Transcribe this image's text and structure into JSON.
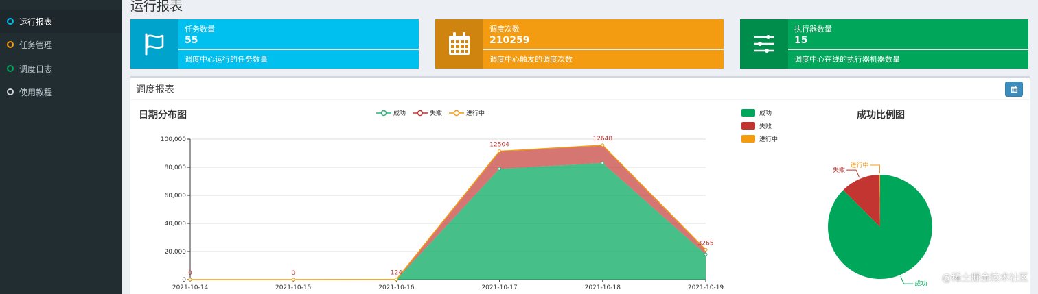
{
  "sidebar": {
    "items": [
      {
        "label": "运行报表",
        "ring": "#00c0ef",
        "active": true
      },
      {
        "label": "任务管理",
        "ring": "#f39c12",
        "active": false
      },
      {
        "label": "调度日志",
        "ring": "#00a65a",
        "active": false
      },
      {
        "label": "使用教程",
        "ring": "#d2d6de",
        "active": false
      }
    ]
  },
  "page": {
    "title": "运行报表"
  },
  "info_boxes": [
    {
      "label": "任务数量",
      "number": "55",
      "desc": "调度中心运行的任务数量",
      "color": "#00c0ef",
      "icon": "flag-icon"
    },
    {
      "label": "调度次数",
      "number": "210259",
      "desc": "调度中心触发的调度次数",
      "color": "#f39c12",
      "icon": "calendar-icon"
    },
    {
      "label": "执行器数量",
      "number": "15",
      "desc": "调度中心在线的执行器机器数量",
      "color": "#00a65a",
      "icon": "sliders-icon"
    }
  ],
  "report": {
    "title": "调度报表"
  },
  "line_chart_title": "日期分布图",
  "pie_chart_title": "成功比例图",
  "legend": [
    "成功",
    "失败",
    "进行中"
  ],
  "watermark": "@稀土掘金技术社区",
  "colors": {
    "success": "#00a65a",
    "fail": "#c23531",
    "running": "#f39c12"
  },
  "chart_data": [
    {
      "type": "area",
      "title": "日期分布图",
      "categories": [
        "2021-10-14",
        "2021-10-15",
        "2021-10-16",
        "2021-10-17",
        "2021-10-18",
        "2021-10-19"
      ],
      "series": [
        {
          "name": "成功",
          "values": [
            0,
            0,
            0,
            78900,
            83000,
            18000
          ]
        },
        {
          "name": "失败",
          "values": [
            0,
            0,
            124,
            12504,
            12648,
            3265
          ]
        },
        {
          "name": "进行中",
          "values": [
            0,
            0,
            0,
            0,
            0,
            0
          ]
        }
      ],
      "ylim": [
        0,
        100000
      ],
      "yticks": [
        "0",
        "20,000",
        "40,000",
        "60,000",
        "80,000",
        "100,000"
      ],
      "data_labels": [
        "0",
        "0",
        "124",
        "12504",
        "12648",
        "3265"
      ]
    },
    {
      "type": "pie",
      "title": "成功比例图",
      "slices": [
        {
          "name": "成功",
          "value": 87.5
        },
        {
          "name": "失败",
          "value": 12.3
        },
        {
          "name": "进行中",
          "value": 0.2
        }
      ]
    }
  ]
}
